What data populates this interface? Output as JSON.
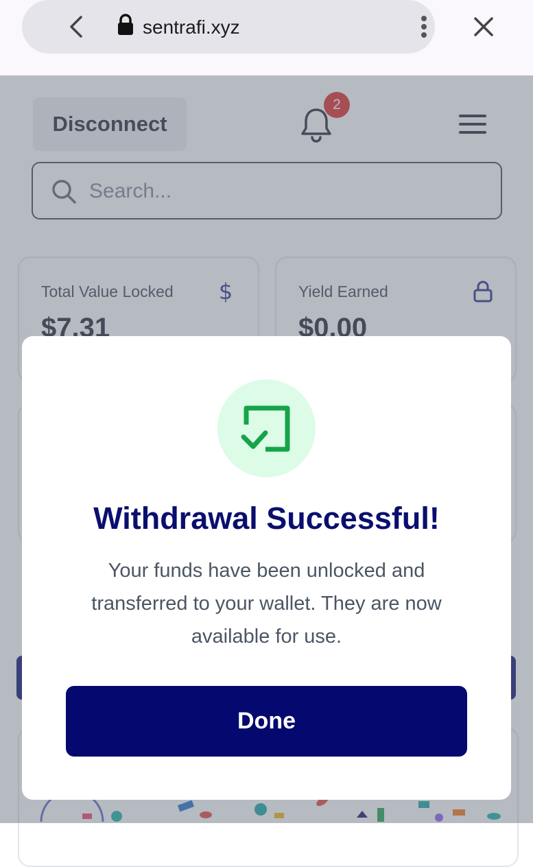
{
  "browser": {
    "url": "sentrafi.xyz"
  },
  "header": {
    "disconnect_label": "Disconnect",
    "notification_count": "2"
  },
  "search": {
    "placeholder": "Search..."
  },
  "stats": [
    {
      "label": "Total Value Locked",
      "value": "$7.31",
      "icon": "dollar-icon"
    },
    {
      "label": "Yield Earned",
      "value": "$0.00",
      "icon": "lock-icon"
    }
  ],
  "modal": {
    "title": "Withdrawal Successful!",
    "body": "Your funds have been unlocked and transferred to your wallet. They are now available for use.",
    "button_label": "Done",
    "icon": "check-square-icon"
  },
  "colors": {
    "brand_navy": "#05086e",
    "success_green": "#16a34a",
    "success_bg": "#dcfce7",
    "badge_red": "#e02424"
  }
}
